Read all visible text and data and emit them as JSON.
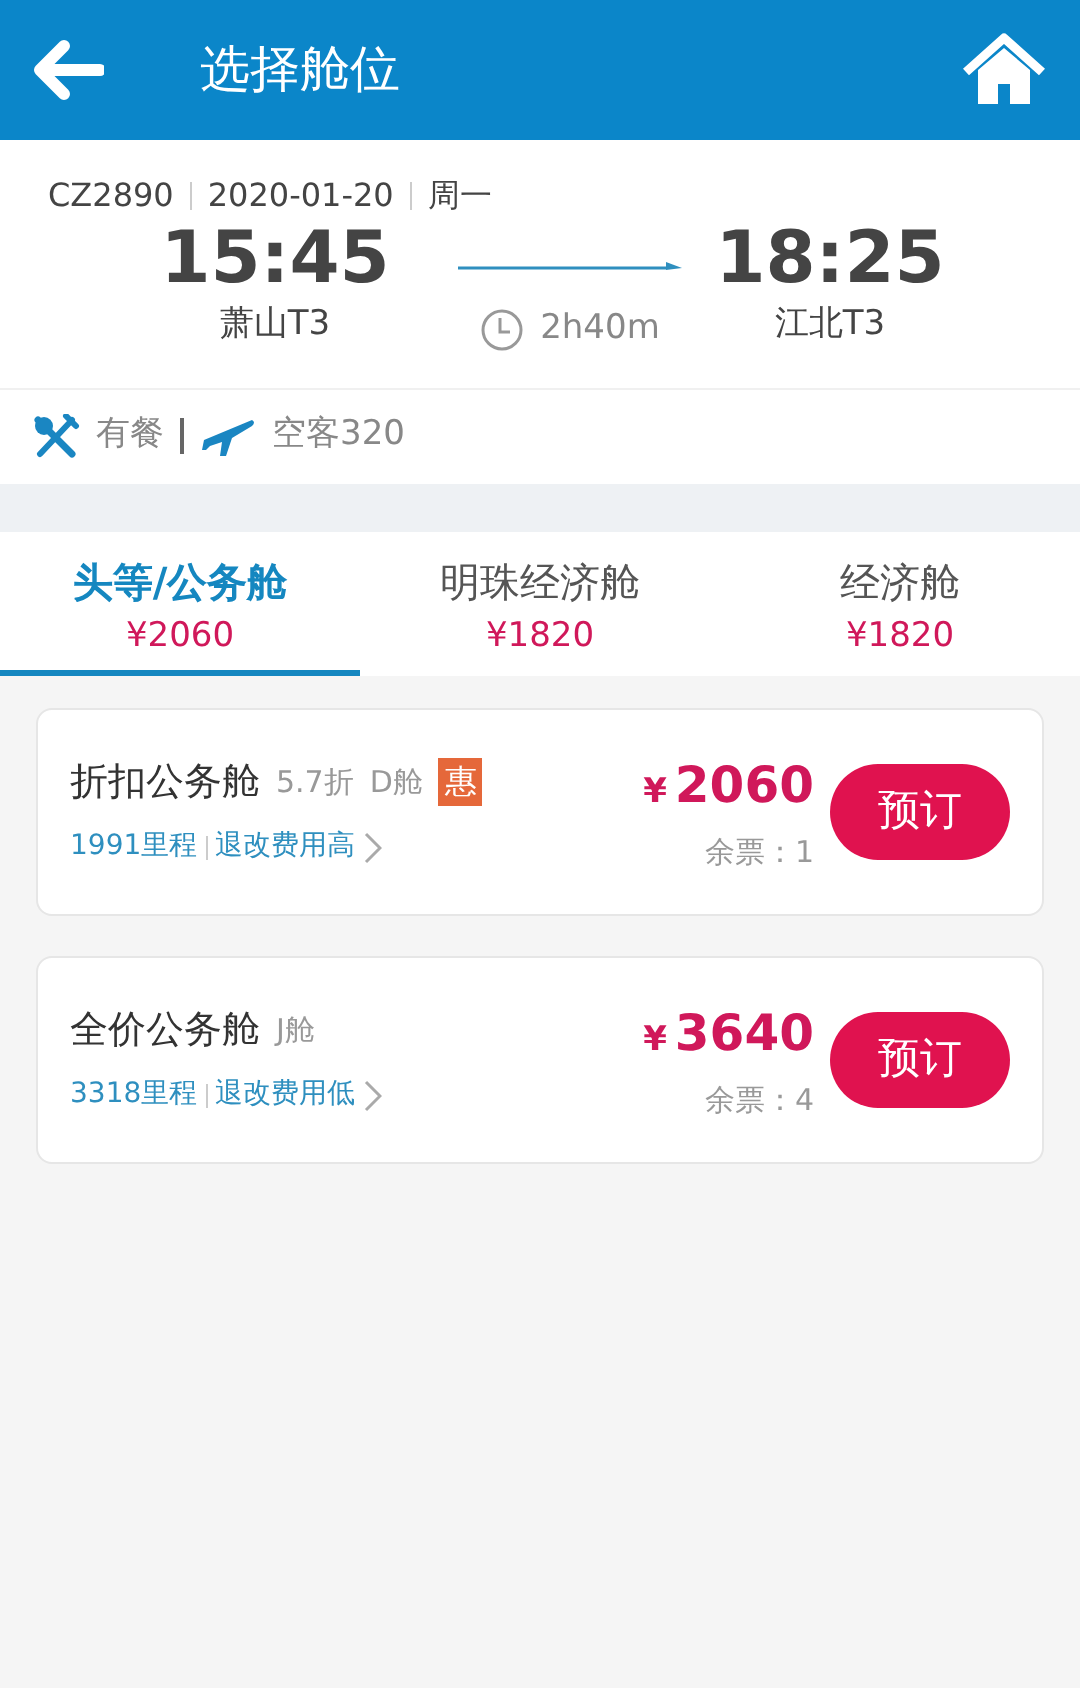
{
  "header": {
    "title": "选择舱位"
  },
  "flight": {
    "number": "CZ2890",
    "date": "2020-01-20",
    "weekday": "周一",
    "depart_time": "15:45",
    "depart_airport": "萧山T3",
    "duration": "2h40m",
    "arrive_time": "18:25",
    "arrive_airport": "江北T3"
  },
  "amenities": {
    "meal": "有餐",
    "aircraft": "空客320"
  },
  "tabs": [
    {
      "label": "头等/公务舱",
      "price": "¥2060",
      "selected": true
    },
    {
      "label": "明珠经济舱",
      "price": "¥1820",
      "selected": false
    },
    {
      "label": "经济舱",
      "price": "¥1820",
      "selected": false
    }
  ],
  "fares": [
    {
      "name": "折扣公务舱",
      "discount": "5.7折",
      "cabin": "D舱",
      "badge": "惠",
      "miles": "1991里程",
      "refund": "退改费用高",
      "currency": "¥",
      "price": "2060",
      "remaining": "余票：1",
      "button": "预订"
    },
    {
      "name": "全价公务舱",
      "cabin": "J舱",
      "miles": "3318里程",
      "refund": "退改费用低",
      "currency": "¥",
      "price": "3640",
      "remaining": "余票：4",
      "button": "预订"
    }
  ]
}
